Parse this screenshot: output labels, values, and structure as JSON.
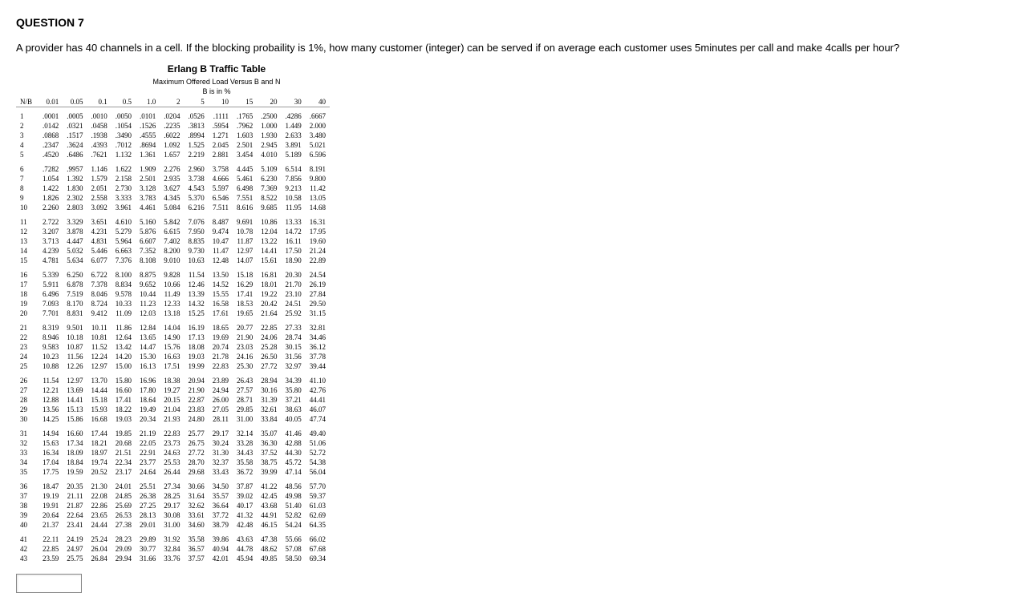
{
  "question_label": "QUESTION 7",
  "question_text": "A provider has 40 channels in a cell. If the blocking probaility is 1%, how many customer (integer) can be served if on average each customer uses 5minutes per call and make 4calls per hour?",
  "table_title": "Erlang B Traffic Table",
  "table_sub1": "Maximum Offered Load Versus B and N",
  "table_sub2": "B is in %",
  "nb_label": "N/B",
  "columns": [
    "0.01",
    "0.05",
    "0.1",
    "0.5",
    "1.0",
    "2",
    "5",
    "10",
    "15",
    "20",
    "30",
    "40"
  ],
  "chart_data": {
    "type": "table",
    "title": "Erlang B Traffic Table — Maximum Offered Load Versus B and N (B in %)",
    "columns": [
      "N/B",
      "0.01",
      "0.05",
      "0.1",
      "0.5",
      "1.0",
      "2",
      "5",
      "10",
      "15",
      "20",
      "30",
      "40"
    ],
    "groups": [
      [
        [
          "1",
          ".0001",
          ".0005",
          ".0010",
          ".0050",
          ".0101",
          ".0204",
          ".0526",
          ".1111",
          ".1765",
          ".2500",
          ".4286",
          ".6667"
        ],
        [
          "2",
          ".0142",
          ".0321",
          ".0458",
          ".1054",
          ".1526",
          ".2235",
          ".3813",
          ".5954",
          ".7962",
          "1.000",
          "1.449",
          "2.000"
        ],
        [
          "3",
          ".0868",
          ".1517",
          ".1938",
          ".3490",
          ".4555",
          ".6022",
          ".8994",
          "1.271",
          "1.603",
          "1.930",
          "2.633",
          "3.480"
        ],
        [
          "4",
          ".2347",
          ".3624",
          ".4393",
          ".7012",
          ".8694",
          "1.092",
          "1.525",
          "2.045",
          "2.501",
          "2.945",
          "3.891",
          "5.021"
        ],
        [
          "5",
          ".4520",
          ".6486",
          ".7621",
          "1.132",
          "1.361",
          "1.657",
          "2.219",
          "2.881",
          "3.454",
          "4.010",
          "5.189",
          "6.596"
        ]
      ],
      [
        [
          "6",
          ".7282",
          ".9957",
          "1.146",
          "1.622",
          "1.909",
          "2.276",
          "2.960",
          "3.758",
          "4.445",
          "5.109",
          "6.514",
          "8.191"
        ],
        [
          "7",
          "1.054",
          "1.392",
          "1.579",
          "2.158",
          "2.501",
          "2.935",
          "3.738",
          "4.666",
          "5.461",
          "6.230",
          "7.856",
          "9.800"
        ],
        [
          "8",
          "1.422",
          "1.830",
          "2.051",
          "2.730",
          "3.128",
          "3.627",
          "4.543",
          "5.597",
          "6.498",
          "7.369",
          "9.213",
          "11.42"
        ],
        [
          "9",
          "1.826",
          "2.302",
          "2.558",
          "3.333",
          "3.783",
          "4.345",
          "5.370",
          "6.546",
          "7.551",
          "8.522",
          "10.58",
          "13.05"
        ],
        [
          "10",
          "2.260",
          "2.803",
          "3.092",
          "3.961",
          "4.461",
          "5.084",
          "6.216",
          "7.511",
          "8.616",
          "9.685",
          "11.95",
          "14.68"
        ]
      ],
      [
        [
          "11",
          "2.722",
          "3.329",
          "3.651",
          "4.610",
          "5.160",
          "5.842",
          "7.076",
          "8.487",
          "9.691",
          "10.86",
          "13.33",
          "16.31"
        ],
        [
          "12",
          "3.207",
          "3.878",
          "4.231",
          "5.279",
          "5.876",
          "6.615",
          "7.950",
          "9.474",
          "10.78",
          "12.04",
          "14.72",
          "17.95"
        ],
        [
          "13",
          "3.713",
          "4.447",
          "4.831",
          "5.964",
          "6.607",
          "7.402",
          "8.835",
          "10.47",
          "11.87",
          "13.22",
          "16.11",
          "19.60"
        ],
        [
          "14",
          "4.239",
          "5.032",
          "5.446",
          "6.663",
          "7.352",
          "8.200",
          "9.730",
          "11.47",
          "12.97",
          "14.41",
          "17.50",
          "21.24"
        ],
        [
          "15",
          "4.781",
          "5.634",
          "6.077",
          "7.376",
          "8.108",
          "9.010",
          "10.63",
          "12.48",
          "14.07",
          "15.61",
          "18.90",
          "22.89"
        ]
      ],
      [
        [
          "16",
          "5.339",
          "6.250",
          "6.722",
          "8.100",
          "8.875",
          "9.828",
          "11.54",
          "13.50",
          "15.18",
          "16.81",
          "20.30",
          "24.54"
        ],
        [
          "17",
          "5.911",
          "6.878",
          "7.378",
          "8.834",
          "9.652",
          "10.66",
          "12.46",
          "14.52",
          "16.29",
          "18.01",
          "21.70",
          "26.19"
        ],
        [
          "18",
          "6.496",
          "7.519",
          "8.046",
          "9.578",
          "10.44",
          "11.49",
          "13.39",
          "15.55",
          "17.41",
          "19.22",
          "23.10",
          "27.84"
        ],
        [
          "19",
          "7.093",
          "8.170",
          "8.724",
          "10.33",
          "11.23",
          "12.33",
          "14.32",
          "16.58",
          "18.53",
          "20.42",
          "24.51",
          "29.50"
        ],
        [
          "20",
          "7.701",
          "8.831",
          "9.412",
          "11.09",
          "12.03",
          "13.18",
          "15.25",
          "17.61",
          "19.65",
          "21.64",
          "25.92",
          "31.15"
        ]
      ],
      [
        [
          "21",
          "8.319",
          "9.501",
          "10.11",
          "11.86",
          "12.84",
          "14.04",
          "16.19",
          "18.65",
          "20.77",
          "22.85",
          "27.33",
          "32.81"
        ],
        [
          "22",
          "8.946",
          "10.18",
          "10.81",
          "12.64",
          "13.65",
          "14.90",
          "17.13",
          "19.69",
          "21.90",
          "24.06",
          "28.74",
          "34.46"
        ],
        [
          "23",
          "9.583",
          "10.87",
          "11.52",
          "13.42",
          "14.47",
          "15.76",
          "18.08",
          "20.74",
          "23.03",
          "25.28",
          "30.15",
          "36.12"
        ],
        [
          "24",
          "10.23",
          "11.56",
          "12.24",
          "14.20",
          "15.30",
          "16.63",
          "19.03",
          "21.78",
          "24.16",
          "26.50",
          "31.56",
          "37.78"
        ],
        [
          "25",
          "10.88",
          "12.26",
          "12.97",
          "15.00",
          "16.13",
          "17.51",
          "19.99",
          "22.83",
          "25.30",
          "27.72",
          "32.97",
          "39.44"
        ]
      ],
      [
        [
          "26",
          "11.54",
          "12.97",
          "13.70",
          "15.80",
          "16.96",
          "18.38",
          "20.94",
          "23.89",
          "26.43",
          "28.94",
          "34.39",
          "41.10"
        ],
        [
          "27",
          "12.21",
          "13.69",
          "14.44",
          "16.60",
          "17.80",
          "19.27",
          "21.90",
          "24.94",
          "27.57",
          "30.16",
          "35.80",
          "42.76"
        ],
        [
          "28",
          "12.88",
          "14.41",
          "15.18",
          "17.41",
          "18.64",
          "20.15",
          "22.87",
          "26.00",
          "28.71",
          "31.39",
          "37.21",
          "44.41"
        ],
        [
          "29",
          "13.56",
          "15.13",
          "15.93",
          "18.22",
          "19.49",
          "21.04",
          "23.83",
          "27.05",
          "29.85",
          "32.61",
          "38.63",
          "46.07"
        ],
        [
          "30",
          "14.25",
          "15.86",
          "16.68",
          "19.03",
          "20.34",
          "21.93",
          "24.80",
          "28.11",
          "31.00",
          "33.84",
          "40.05",
          "47.74"
        ]
      ],
      [
        [
          "31",
          "14.94",
          "16.60",
          "17.44",
          "19.85",
          "21.19",
          "22.83",
          "25.77",
          "29.17",
          "32.14",
          "35.07",
          "41.46",
          "49.40"
        ],
        [
          "32",
          "15.63",
          "17.34",
          "18.21",
          "20.68",
          "22.05",
          "23.73",
          "26.75",
          "30.24",
          "33.28",
          "36.30",
          "42.88",
          "51.06"
        ],
        [
          "33",
          "16.34",
          "18.09",
          "18.97",
          "21.51",
          "22.91",
          "24.63",
          "27.72",
          "31.30",
          "34.43",
          "37.52",
          "44.30",
          "52.72"
        ],
        [
          "34",
          "17.04",
          "18.84",
          "19.74",
          "22.34",
          "23.77",
          "25.53",
          "28.70",
          "32.37",
          "35.58",
          "38.75",
          "45.72",
          "54.38"
        ],
        [
          "35",
          "17.75",
          "19.59",
          "20.52",
          "23.17",
          "24.64",
          "26.44",
          "29.68",
          "33.43",
          "36.72",
          "39.99",
          "47.14",
          "56.04"
        ]
      ],
      [
        [
          "36",
          "18.47",
          "20.35",
          "21.30",
          "24.01",
          "25.51",
          "27.34",
          "30.66",
          "34.50",
          "37.87",
          "41.22",
          "48.56",
          "57.70"
        ],
        [
          "37",
          "19.19",
          "21.11",
          "22.08",
          "24.85",
          "26.38",
          "28.25",
          "31.64",
          "35.57",
          "39.02",
          "42.45",
          "49.98",
          "59.37"
        ],
        [
          "38",
          "19.91",
          "21.87",
          "22.86",
          "25.69",
          "27.25",
          "29.17",
          "32.62",
          "36.64",
          "40.17",
          "43.68",
          "51.40",
          "61.03"
        ],
        [
          "39",
          "20.64",
          "22.64",
          "23.65",
          "26.53",
          "28.13",
          "30.08",
          "33.61",
          "37.72",
          "41.32",
          "44.91",
          "52.82",
          "62.69"
        ],
        [
          "40",
          "21.37",
          "23.41",
          "24.44",
          "27.38",
          "29.01",
          "31.00",
          "34.60",
          "38.79",
          "42.48",
          "46.15",
          "54.24",
          "64.35"
        ]
      ],
      [
        [
          "41",
          "22.11",
          "24.19",
          "25.24",
          "28.23",
          "29.89",
          "31.92",
          "35.58",
          "39.86",
          "43.63",
          "47.38",
          "55.66",
          "66.02"
        ],
        [
          "42",
          "22.85",
          "24.97",
          "26.04",
          "29.09",
          "30.77",
          "32.84",
          "36.57",
          "40.94",
          "44.78",
          "48.62",
          "57.08",
          "67.68"
        ],
        [
          "43",
          "23.59",
          "25.75",
          "26.84",
          "29.94",
          "31.66",
          "33.76",
          "37.57",
          "42.01",
          "45.94",
          "49.85",
          "58.50",
          "69.34"
        ]
      ]
    ]
  }
}
